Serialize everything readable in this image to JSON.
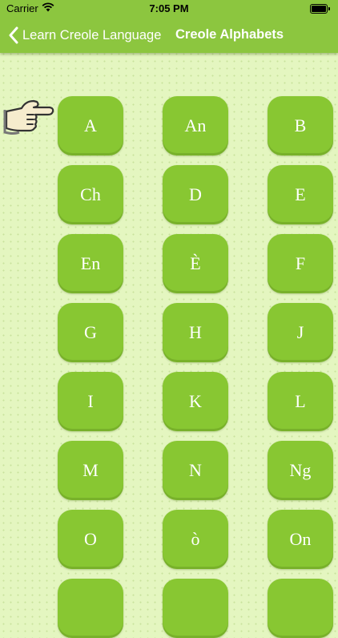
{
  "status_bar": {
    "carrier": "Carrier",
    "time": "7:05 PM"
  },
  "nav": {
    "back_label": "Learn Creole Language",
    "title": "Creole Alphabets"
  },
  "colors": {
    "accent": "#8cc63f",
    "key": "#88c732",
    "background": "#e4f6c0"
  },
  "pointer_icon": "pointing-hand-icon",
  "letters": [
    "A",
    "An",
    "B",
    "Ch",
    "D",
    "E",
    "En",
    "È",
    "F",
    "G",
    "H",
    "J",
    "I",
    "K",
    "L",
    "M",
    "N",
    "Ng",
    "O",
    "ò",
    "On",
    "",
    "",
    ""
  ]
}
